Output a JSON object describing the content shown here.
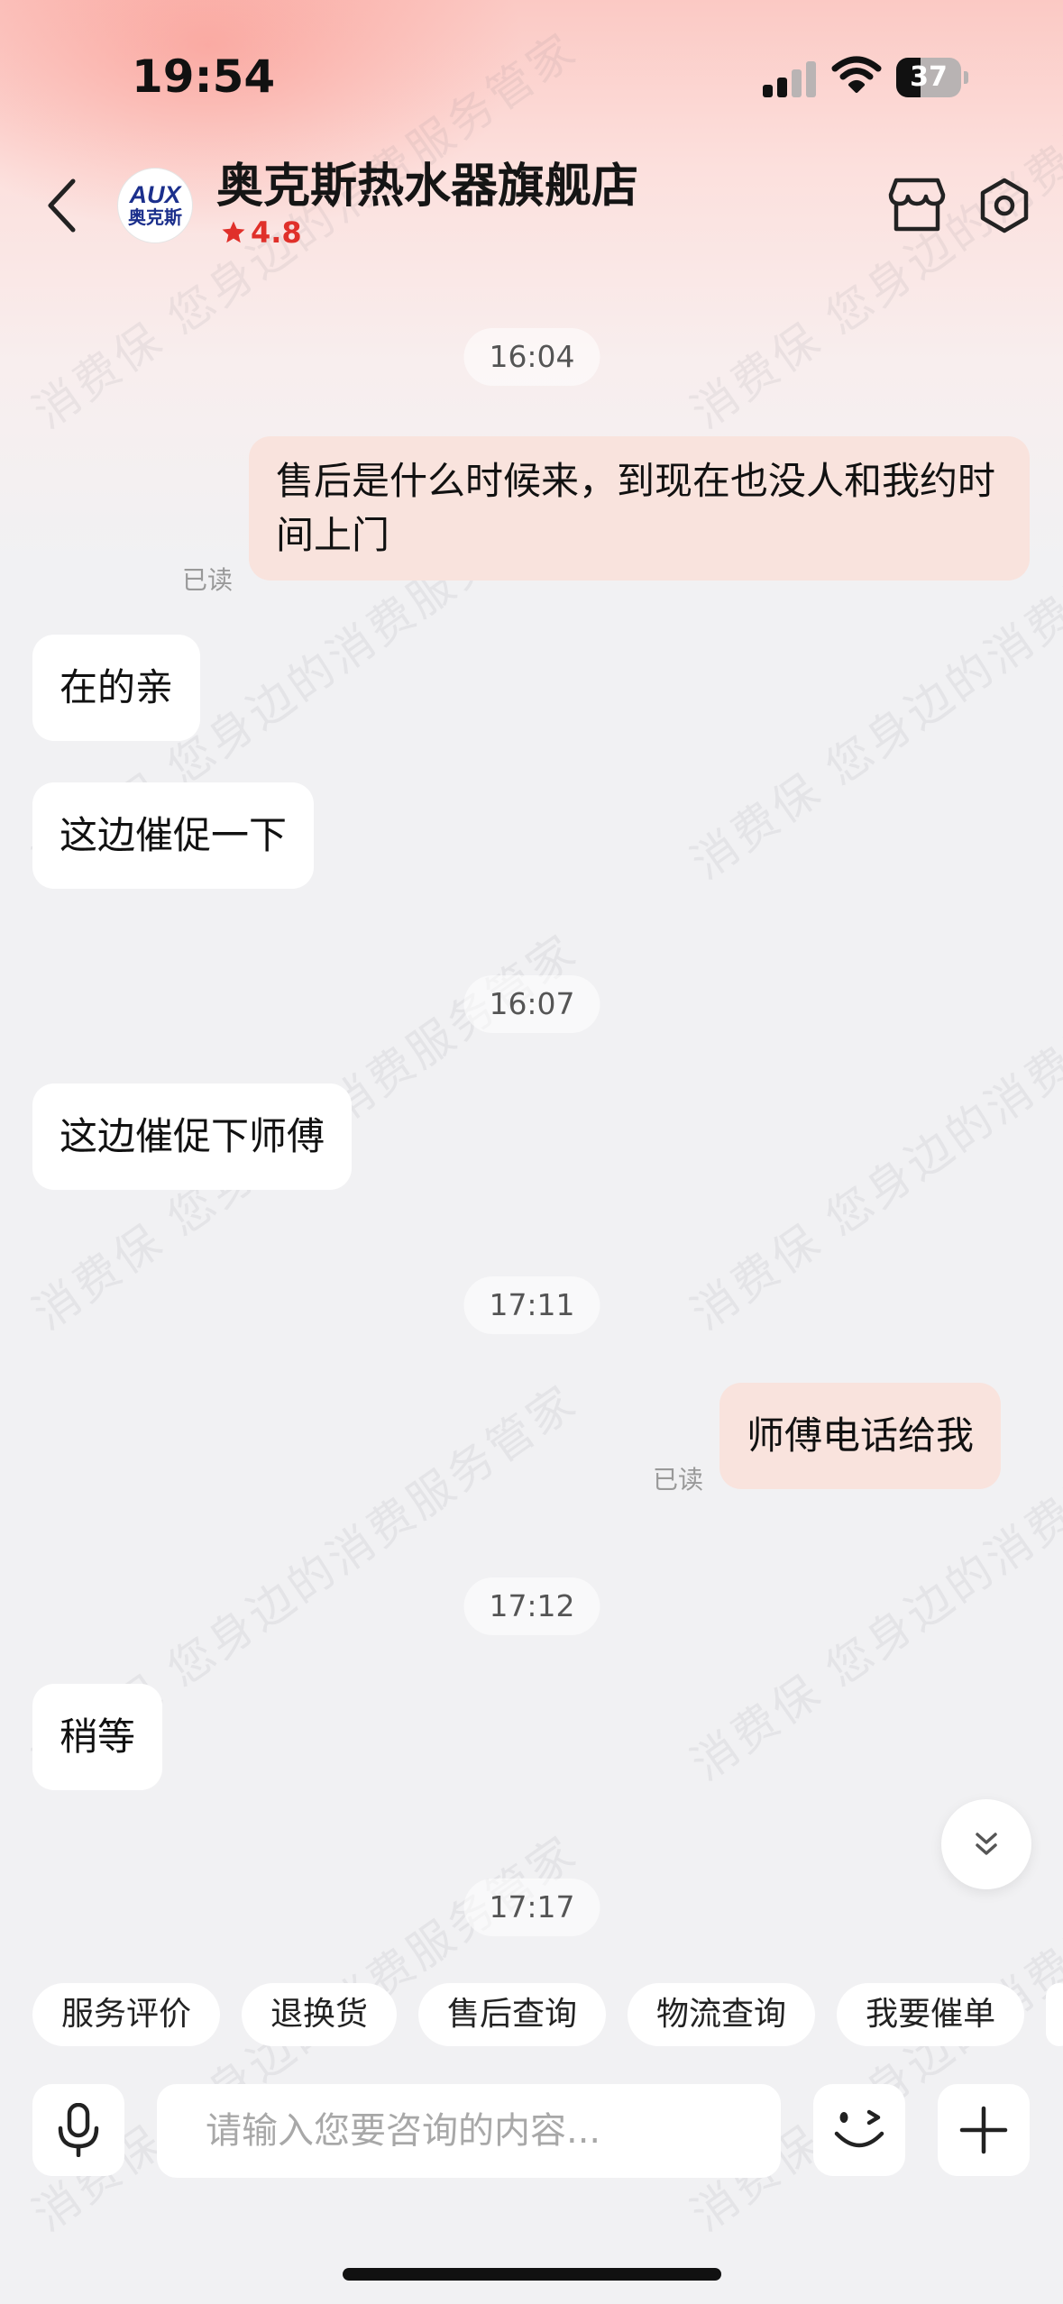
{
  "status_bar": {
    "time": "19:54",
    "battery": "37",
    "battery_level": 0.37
  },
  "header": {
    "store_name": "奥克斯热水器旗舰店",
    "logo_text": "AUX",
    "logo_cn": "奥克斯",
    "rating": "4.8",
    "icons": [
      "back-chevron-icon",
      "storefront-icon",
      "settings-icon",
      "star-icon"
    ]
  },
  "watermark": "消费保 您身边的消费服务管家",
  "messages": [
    {
      "type": "time",
      "text": "16:04"
    },
    {
      "type": "sent",
      "text": "售后是什么时候来，到现在也没人和我约时间上门",
      "status": "已读"
    },
    {
      "type": "received",
      "text": "在的亲"
    },
    {
      "type": "received",
      "text": "这边催促一下"
    },
    {
      "type": "time",
      "text": "16:07"
    },
    {
      "type": "received",
      "text": "这边催促下师傅"
    },
    {
      "type": "time",
      "text": "17:11"
    },
    {
      "type": "sent",
      "text": "师傅电话给我",
      "status": "已读"
    },
    {
      "type": "time",
      "text": "17:12"
    },
    {
      "type": "received",
      "text": "稍等"
    },
    {
      "type": "time",
      "text": "17:17"
    }
  ],
  "quick_replies": [
    "服务评价",
    "退换货",
    "售后查询",
    "物流查询",
    "我要催单"
  ],
  "input": {
    "placeholder": "请输入您要咨询的内容..."
  },
  "colors": {
    "accent": "#e0302a",
    "sent_bubble": "#f9e3dd",
    "received_bubble": "#ffffff",
    "background": "#f1f1f3",
    "logo_blue": "#1b2f8c"
  }
}
